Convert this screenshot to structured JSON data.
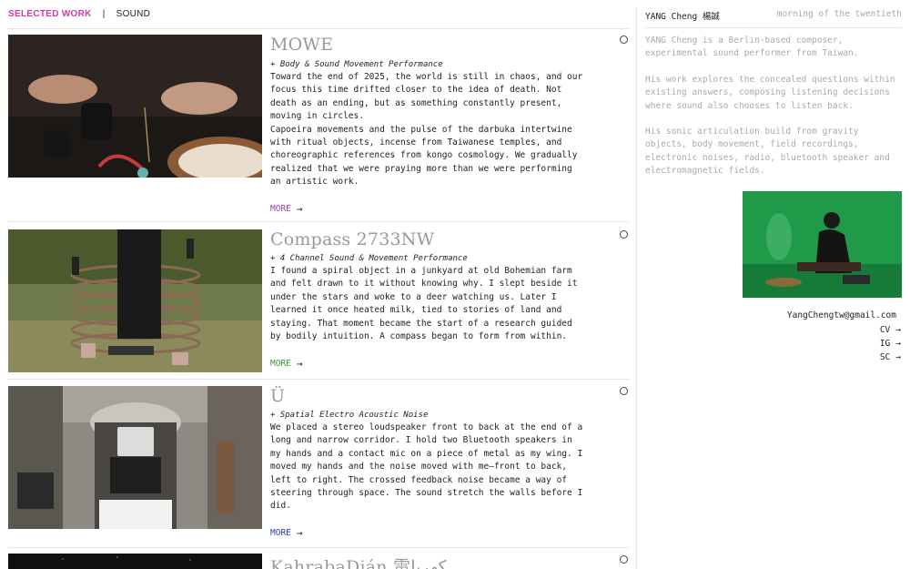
{
  "nav": {
    "selected_work": "SELECTED WORK",
    "separator": "|",
    "sound": "SOUND"
  },
  "works": [
    {
      "title": "MOWE",
      "subtitle": "+ Body & Sound Movement Performance",
      "description": "Toward the end of 2025, the world is still in chaos, and our focus this time drifted closer to the idea of death. Not death as an ending, but as something constantly present, moving in circles.\nCapoeira movements and the pulse of the darbuka intertwine with ritual objects, incense from Taiwanese temples, and choreographic references from kongo cosmology. We gradually realized that we were praying more than we were performing an artistic work.",
      "more_label": "MORE",
      "more_color": "#9b3fb3"
    },
    {
      "title": "Compass 2733NW",
      "subtitle": "+ 4 Channel Sound & Movement Performance",
      "description": "I found a spiral object in a junkyard at old Bohemian farm and felt drawn to it without knowing why. I slept beside it under the stars and woke to a deer watching us. Later I learned it once heated milk, tied to stories of land and staying. That moment became the start of a research guided by bodily intuition. A compass began to form from within.",
      "more_label": "MORE",
      "more_color": "#3a9b3a"
    },
    {
      "title": "Ü",
      "subtitle": "+ Spatial Electro Acoustic Noise",
      "description": "We placed a stereo loudspeaker front to back at the end of a long and narrow corridor. I hold two Bluetooth speakers in my hands and a contact mic on a piece of metal as my wing. I moved my hands and the noise moved with me—front to back, left to right. The crossed feedback noise became a way of steering through space. The sound stretch the walls before I did.",
      "more_label": "MORE",
      "more_color": "#2f3fb3"
    },
    {
      "title": "KahrabaDián 電كهربا",
      "subtitle": "",
      "description": "",
      "more_label": "",
      "more_color": "#222222"
    }
  ],
  "sidebar": {
    "name": "YANG Cheng 楊誠",
    "time": "morning of the twentieth",
    "bio": [
      "YANG Cheng is a Berlin-based composer, experimental sound performer from Taiwan.",
      "His work explores the concealed questions within existing answers, composing listening decisions where sound also chooses to listen back.",
      "His sonic articulation build from gravity objects, body movement, field recordings, electronic noises, radio, bluetooth speaker and electromagnetic fields."
    ],
    "email": "YangChengtw@gmail.com",
    "links": [
      {
        "label": "CV"
      },
      {
        "label": "IG"
      },
      {
        "label": "SC"
      }
    ]
  },
  "icons": {
    "arrow": "→",
    "radio": "radio-circle-icon"
  }
}
